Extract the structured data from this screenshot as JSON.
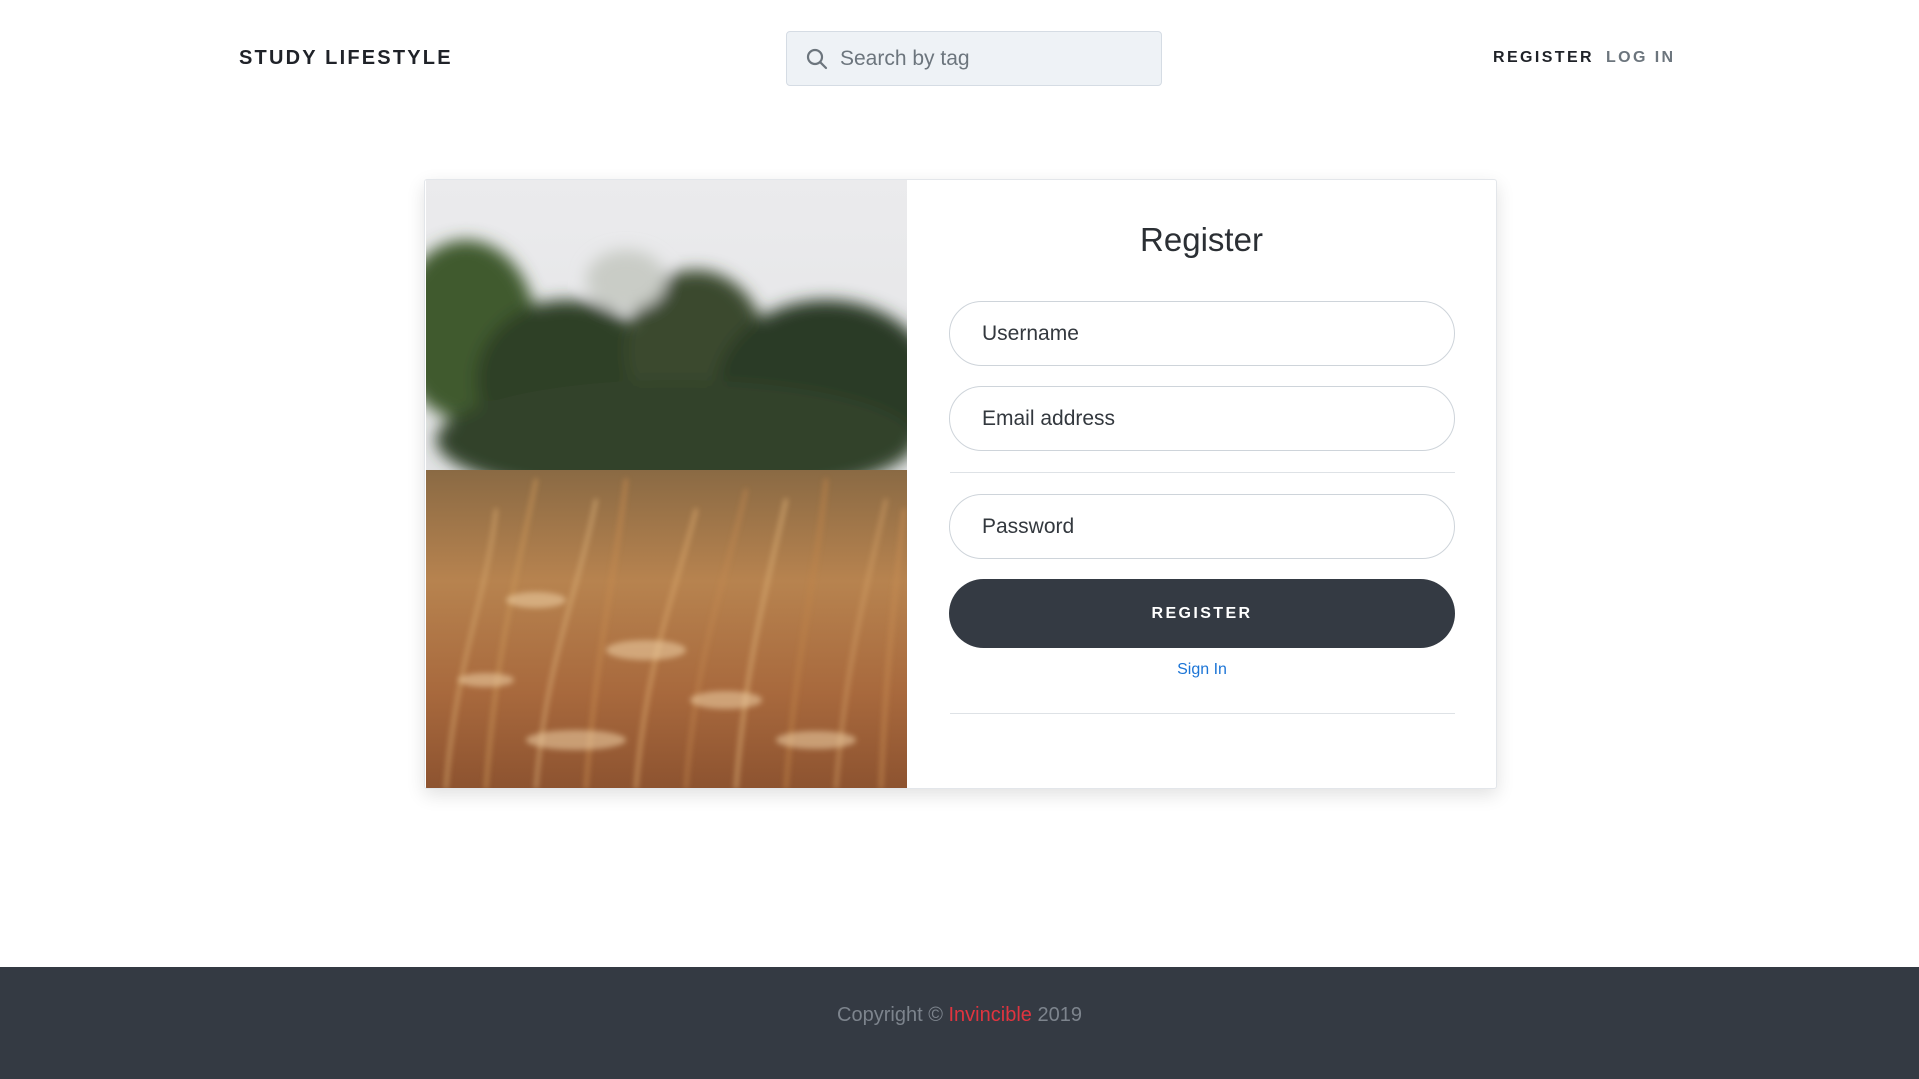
{
  "header": {
    "brand": "STUDY LIFESTYLE",
    "search_placeholder": "Search by tag",
    "nav": {
      "register": "REGISTER",
      "login": "LOG IN"
    }
  },
  "form": {
    "title": "Register",
    "username_placeholder": "Username",
    "email_placeholder": "Email address",
    "password_placeholder": "Password",
    "submit_label": "REGISTER",
    "signin_label": "Sign In"
  },
  "footer": {
    "prefix": "Copyright ©",
    "brand": "Invincible",
    "year": "2019"
  },
  "colors": {
    "dark": "#343a43",
    "link": "#1b74d6",
    "brand_accent": "#e0343f",
    "search_bg": "#eef2f6"
  }
}
